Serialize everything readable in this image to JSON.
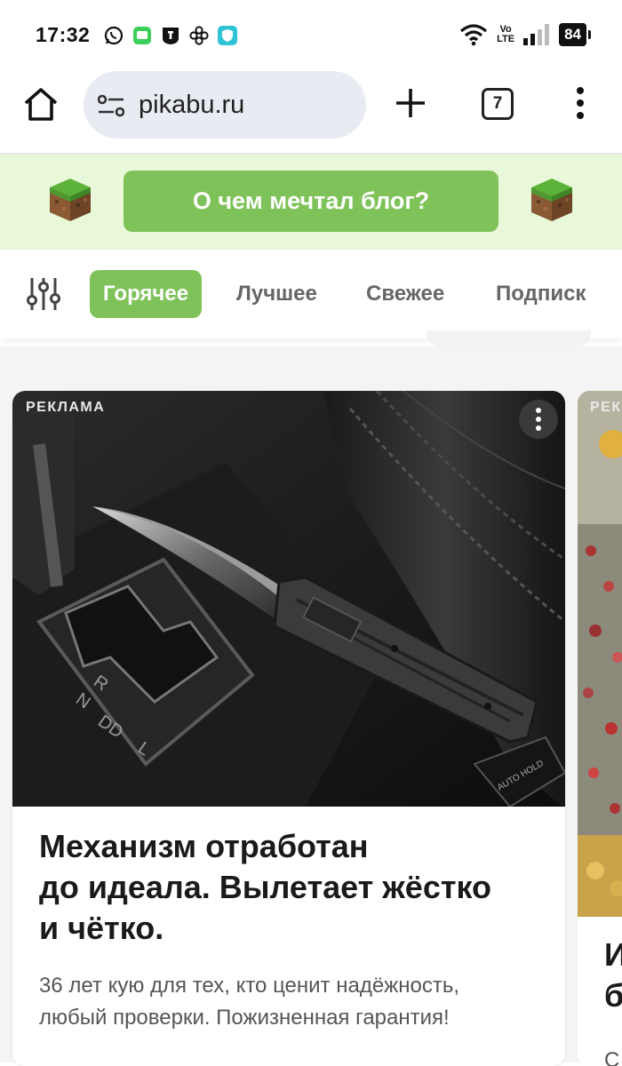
{
  "status_bar": {
    "time": "17:32",
    "network_top": "Vo",
    "network_bottom": "LTE",
    "battery": "84",
    "notification_icons": [
      "whatsapp-icon",
      "messages-icon",
      "tutanota-icon",
      "pinwheel-icon",
      "shield-icon"
    ]
  },
  "browser": {
    "url": "pikabu.ru",
    "tab_count": "7"
  },
  "promo": {
    "button_label": "О чем мечтал блог?"
  },
  "feed_tabs": {
    "items": [
      {
        "label": "Горячее",
        "active": true
      },
      {
        "label": "Лучшее",
        "active": false
      },
      {
        "label": "Свежее",
        "active": false
      },
      {
        "label": "Подписк",
        "active": false
      }
    ]
  },
  "ad_card": {
    "ad_label": "РЕКЛАМА",
    "title_line1": "Механизм отработан",
    "title_line2": "до идеала. Вылетает жёстко",
    "title_line3": "и чётко.",
    "desc_line1": "36 лет кую для тех, кто ценит надёжность,",
    "desc_line2": "любый проверки. Пожизненная гарантия!"
  },
  "ad_card_2": {
    "ad_label": "РЕК",
    "title_line1": "И",
    "title_line2": "б",
    "desc": "С"
  },
  "colors": {
    "accent_green": "#7fc25a",
    "promo_bg": "#e9f8d9",
    "urlbar_bg": "#e9ebf3"
  }
}
